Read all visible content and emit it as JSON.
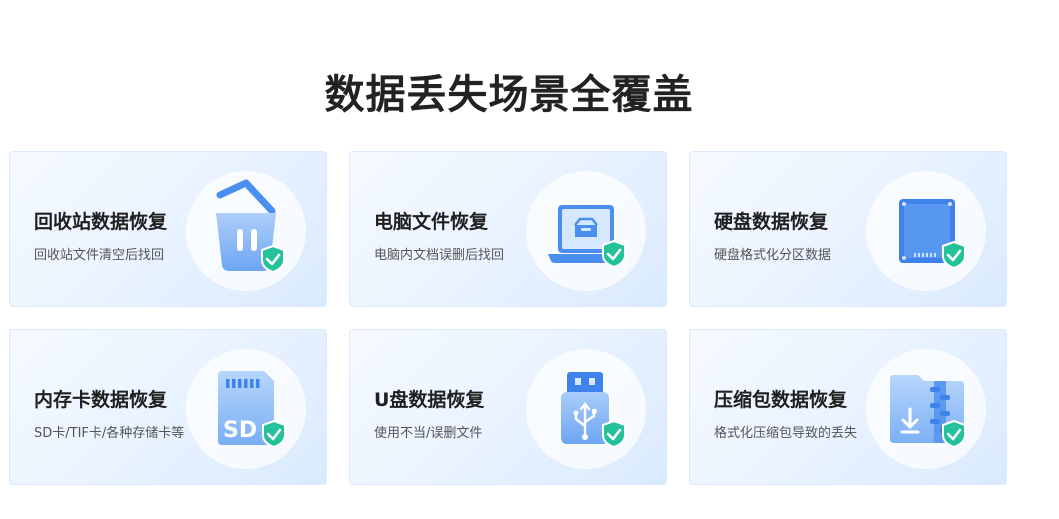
{
  "page": {
    "title": "数据丢失场景全覆盖"
  },
  "cards": [
    {
      "title": "回收站数据恢复",
      "desc": "回收站文件清空后找回",
      "icon": "recycle-bin-icon"
    },
    {
      "title": "电脑文件恢复",
      "desc": "电脑内文档误删后找回",
      "icon": "laptop-icon"
    },
    {
      "title": "硬盘数据恢复",
      "desc": "硬盘格式化分区数据",
      "icon": "hard-drive-icon"
    },
    {
      "title": "内存卡数据恢复",
      "desc": "SD卡/TIF卡/各种存储卡等",
      "icon": "sd-card-icon"
    },
    {
      "title": "U盘数据恢复",
      "desc": "使用不当/误删文件",
      "icon": "usb-drive-icon"
    },
    {
      "title": "压缩包数据恢复",
      "desc": "格式化压缩包导致的丢失",
      "icon": "zip-archive-icon"
    }
  ],
  "icons": {
    "sd_label": "SD"
  },
  "colors": {
    "accent": "#4a8ff0",
    "shield": "#23c29b",
    "title": "#222222"
  }
}
